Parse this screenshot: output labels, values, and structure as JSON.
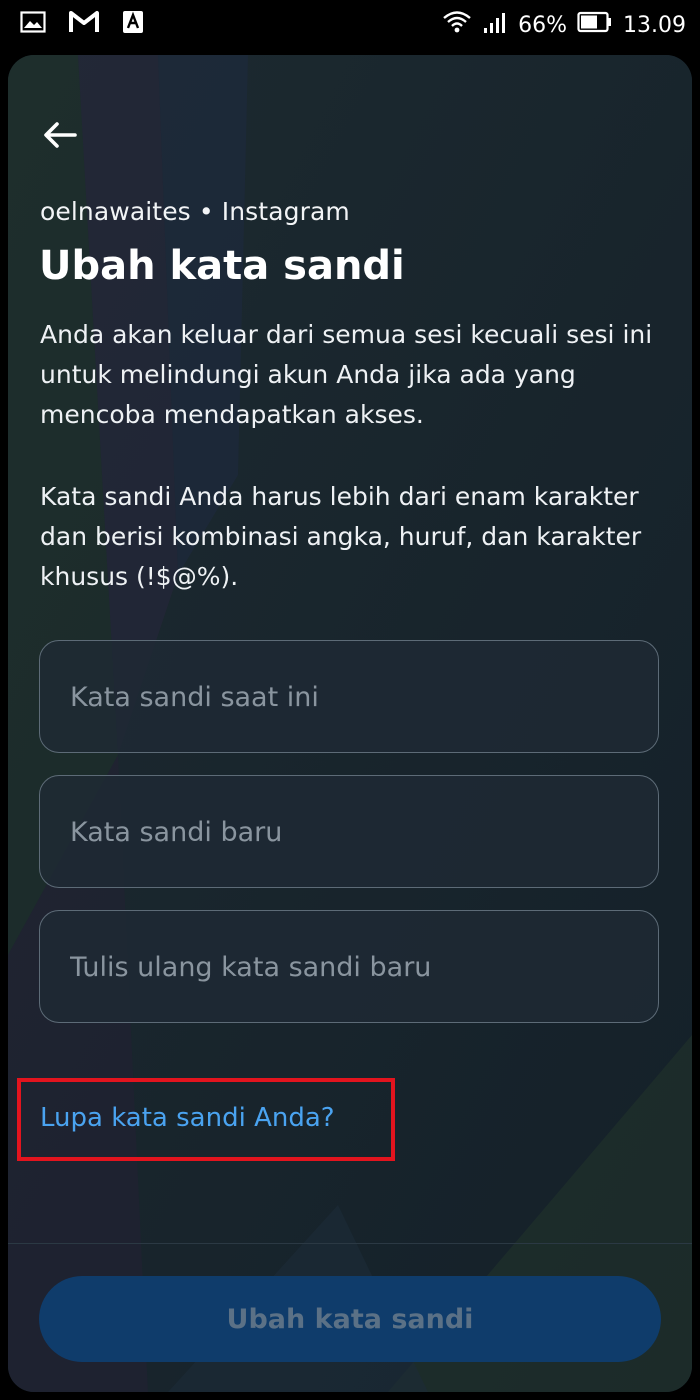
{
  "status_bar": {
    "icons_left": [
      "gallery-icon",
      "gmail-icon",
      "keyboard-icon"
    ],
    "battery_percent": "66%",
    "time": "13.09"
  },
  "header": {
    "back_icon": "arrow-left-icon",
    "account": "oelnawaites • Instagram",
    "title": "Ubah kata sandi"
  },
  "description": {
    "paragraph1": "Anda akan keluar dari semua sesi kecuali sesi ini untuk melindungi akun Anda jika ada yang mencoba mendapatkan akses.",
    "paragraph2": "Kata sandi Anda harus lebih dari enam karakter dan berisi kombinasi angka, huruf, dan karakter khusus (!$@%)."
  },
  "form": {
    "current_password": {
      "value": "",
      "placeholder": "Kata sandi saat ini"
    },
    "new_password": {
      "value": "",
      "placeholder": "Kata sandi baru"
    },
    "confirm_password": {
      "value": "",
      "placeholder": "Tulis ulang kata sandi baru"
    }
  },
  "forgot_link": "Lupa kata sandi Anda?",
  "submit_label": "Ubah kata sandi",
  "colors": {
    "link": "#4aa3f0",
    "highlight_box": "#e3141e",
    "button_disabled": "#0f3c6b"
  }
}
